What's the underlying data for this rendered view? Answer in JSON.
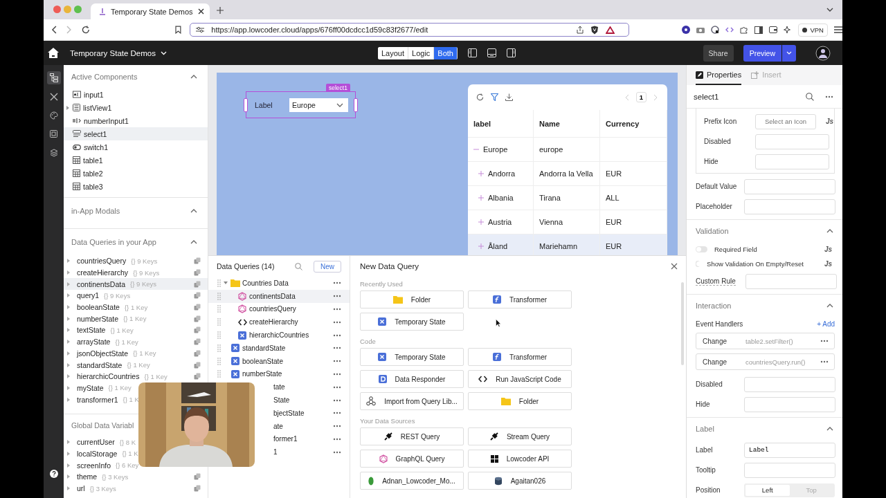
{
  "browser": {
    "tab_title": "Temporary State Demos",
    "url": "https://app.lowcoder.cloud/apps/676ff00dcdcc1d59c83f2677/edit",
    "vpn": "VPN"
  },
  "app_header": {
    "title": "Temporary State Demos",
    "share": "Share",
    "preview": "Preview",
    "modes": [
      {
        "label": "Layout",
        "selected": false
      },
      {
        "label": "Logic",
        "selected": false
      },
      {
        "label": "Both",
        "selected": true
      }
    ]
  },
  "left_rail": [
    {
      "kind": "tree",
      "selected": true
    },
    {
      "kind": "tools",
      "selected": false
    },
    {
      "kind": "palette",
      "selected": false
    },
    {
      "kind": "layout",
      "selected": false
    },
    {
      "kind": "layers",
      "selected": false
    }
  ],
  "active_components": {
    "title": "Active Components",
    "expanded": true,
    "items": [
      {
        "name": "input1",
        "kind": "input",
        "selected": false,
        "has_children": false
      },
      {
        "name": "listView1",
        "kind": "list",
        "selected": false,
        "has_children": true
      },
      {
        "name": "numberInput1",
        "kind": "number",
        "selected": false,
        "has_children": false
      },
      {
        "name": "select1",
        "kind": "select",
        "selected": true,
        "has_children": false
      },
      {
        "name": "switch1",
        "kind": "switch",
        "selected": false,
        "has_children": false
      },
      {
        "name": "table1",
        "kind": "table",
        "selected": false,
        "has_children": false
      },
      {
        "name": "table2",
        "kind": "table",
        "selected": false,
        "has_children": false
      },
      {
        "name": "table3",
        "kind": "table",
        "selected": false,
        "has_children": false
      }
    ]
  },
  "in_app_modals": {
    "title": "in-App Modals",
    "expanded": true
  },
  "data_queries": {
    "title": "Data Queries in your App",
    "expanded": true,
    "items": [
      {
        "name": "countriesQuery",
        "keys": "{} 9 Keys",
        "selected": false,
        "copy_visible": true
      },
      {
        "name": "createHierarchy",
        "keys": "{} 9 Keys",
        "selected": false,
        "copy_visible": true
      },
      {
        "name": "continentsData",
        "keys": "{} 9 Keys",
        "selected": true,
        "copy_visible": true
      },
      {
        "name": "query1",
        "keys": "{} 9 Keys",
        "selected": false,
        "copy_visible": true
      },
      {
        "name": "booleanState",
        "keys": "{} 1 Key",
        "selected": false,
        "copy_visible": true
      },
      {
        "name": "numberState",
        "keys": "{} 1 Key",
        "selected": false,
        "copy_visible": true
      },
      {
        "name": "textState",
        "keys": "{} 1 Key",
        "selected": false,
        "copy_visible": true
      },
      {
        "name": "arrayState",
        "keys": "{} 1 Key",
        "selected": false,
        "copy_visible": true
      },
      {
        "name": "jsonObjectState",
        "keys": "{} 1 Key",
        "selected": false,
        "copy_visible": true
      },
      {
        "name": "standardState",
        "keys": "{} 1 Key",
        "selected": false,
        "copy_visible": true
      },
      {
        "name": "hierarchicCountries",
        "keys": "{} 1 Key",
        "selected": false,
        "copy_visible": true
      },
      {
        "name": "myState",
        "keys": "{} 1 Key",
        "selected": false
      },
      {
        "name": "transformer1",
        "keys": "{} 1 K",
        "selected": false
      }
    ]
  },
  "global_variables": {
    "title": "Global Data Variabl",
    "items": [
      {
        "name": "currentUser",
        "keys": "{} 8 K"
      },
      {
        "name": "localStorage",
        "keys": "{} 1 K"
      },
      {
        "name": "screenInfo",
        "keys": "{} 6 Key"
      },
      {
        "name": "theme",
        "keys": "{} 3 Keys",
        "copy_visible": true
      },
      {
        "name": "url",
        "keys": "{} 3 Keys",
        "copy_visible": true
      }
    ]
  },
  "canvas": {
    "select": {
      "tag": "select1",
      "label": "Label",
      "value": "Europe"
    },
    "table": {
      "page": "1",
      "columns": [
        "label",
        "Name",
        "Currency"
      ],
      "rows": [
        {
          "label": "Europe",
          "name": "europe",
          "expanded": true,
          "selected": false,
          "children": [
            {
              "label": "Andorra",
              "name": "Andorra la Vella",
              "currency": "EUR",
              "expanded": false,
              "selected": false
            },
            {
              "label": "Albania",
              "name": "Tirana",
              "currency": "ALL",
              "expanded": false,
              "selected": false
            },
            {
              "label": "Austria",
              "name": "Vienna",
              "currency": "EUR",
              "expanded": false,
              "selected": false
            },
            {
              "label": "Åland",
              "name": "Mariehamn",
              "currency": "EUR",
              "expanded": false,
              "selected": true
            }
          ]
        }
      ]
    }
  },
  "query_list": {
    "title": "Data Queries (14)",
    "new_button": "New",
    "items": [
      {
        "name": "Countries Data",
        "kind": "folder",
        "expanded": true,
        "selected": false,
        "children": [
          {
            "name": "continentsData",
            "kind": "graphql",
            "selected": true
          },
          {
            "name": "countriesQuery",
            "kind": "graphql",
            "selected": false
          },
          {
            "name": "createHierarchy",
            "kind": "js",
            "selected": false
          },
          {
            "name": "hierarchicCountries",
            "kind": "state",
            "selected": false
          }
        ]
      },
      {
        "name": "standardState",
        "kind": "state",
        "selected": false
      },
      {
        "name": "booleanState",
        "kind": "state",
        "selected": false
      },
      {
        "name": "numberState",
        "kind": "state",
        "selected": false
      },
      {
        "name": "tate",
        "clipped": true,
        "selected": false
      },
      {
        "name": "State",
        "clipped": true,
        "selected": false
      },
      {
        "name": "bjectState",
        "clipped": true,
        "selected": false
      },
      {
        "name": "ate",
        "clipped": true,
        "selected": false
      },
      {
        "name": "former1",
        "clipped": true,
        "selected": false
      },
      {
        "name": "1",
        "clipped": true,
        "selected": false
      }
    ]
  },
  "new_query": {
    "title": "New Data Query",
    "sections": [
      {
        "title": "Recently Used",
        "options": [
          {
            "label": "Folder",
            "kind": "folder"
          },
          {
            "label": "Transformer",
            "kind": "transformer"
          },
          {
            "label": "Temporary State",
            "kind": "state"
          }
        ]
      },
      {
        "title": "Code",
        "options": [
          {
            "label": "Temporary State",
            "kind": "state"
          },
          {
            "label": "Transformer",
            "kind": "transformer"
          },
          {
            "label": "Data Responder",
            "kind": "responder"
          },
          {
            "label": "Run JavaScript Code",
            "kind": "js"
          },
          {
            "label": "Import from Query Lib...",
            "kind": "library"
          },
          {
            "label": "Folder",
            "kind": "folder"
          }
        ]
      },
      {
        "title": "Your Data Sources",
        "options": [
          {
            "label": "REST Query",
            "kind": "plug"
          },
          {
            "label": "Stream Query",
            "kind": "plug"
          },
          {
            "label": "GraphQL Query",
            "kind": "graphql"
          },
          {
            "label": "Lowcoder API",
            "kind": "api"
          },
          {
            "label": "Adnan_Lowcoder_Mo...",
            "kind": "mongo"
          },
          {
            "label": "Agaitan026",
            "kind": "database"
          }
        ]
      }
    ]
  },
  "properties": {
    "tabs": [
      {
        "label": "Properties",
        "selected": true
      },
      {
        "label": "Insert",
        "selected": false
      }
    ],
    "component": "select1",
    "prefix_group": [
      {
        "label": "Prefix Icon",
        "placeholder": "Select an Icon",
        "js": "Js"
      },
      {
        "label": "Disabled"
      },
      {
        "label": "Hide"
      }
    ],
    "fields": [
      {
        "label": "Default Value"
      },
      {
        "label": "Placeholder"
      }
    ],
    "validation": {
      "title": "Validation",
      "expanded": true,
      "toggles": [
        {
          "label": "Required Field",
          "on": false,
          "js": "Js"
        },
        {
          "label": "Show Validation On Empty/Reset",
          "on": false,
          "js": "Js"
        }
      ],
      "custom_rule": "Custom Rule"
    },
    "interaction": {
      "title": "Interaction",
      "expanded": true,
      "event_handlers": "Event Handlers",
      "add": "+ Add",
      "handlers": [
        {
          "event": "Change",
          "action": "table2.setFilter()"
        },
        {
          "event": "Change",
          "action": "countriesQuery.run()"
        }
      ],
      "fields": [
        {
          "label": "Disabled"
        },
        {
          "label": "Hide"
        }
      ]
    },
    "label_section": {
      "title": "Label",
      "expanded": true,
      "fields": [
        {
          "label": "Label",
          "value": "Label"
        },
        {
          "label": "Tooltip"
        }
      ],
      "position": {
        "label": "Position",
        "options": [
          {
            "label": "Left",
            "selected": true
          },
          {
            "label": "Top",
            "selected": false
          }
        ]
      }
    }
  }
}
